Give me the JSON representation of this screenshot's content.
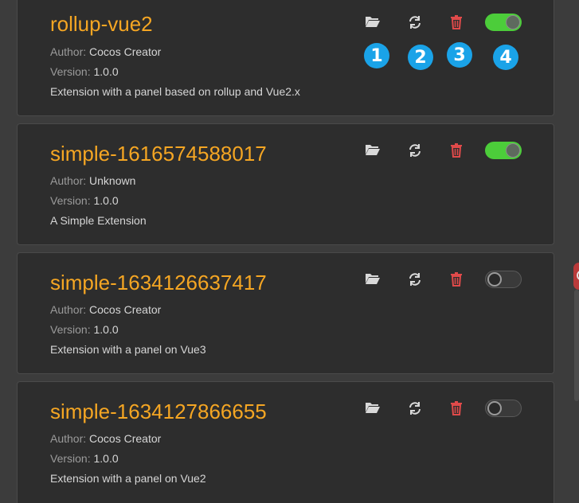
{
  "extensions": [
    {
      "name": "rollup-vue2",
      "author_label": "Author:",
      "author": "Cocos Creator",
      "version_label": "Version:",
      "version": "1.0.0",
      "description": "Extension with a panel based on rollup and Vue2.x",
      "enabled": true
    },
    {
      "name": "simple-1616574588017",
      "author_label": "Author:",
      "author": "Unknown",
      "version_label": "Version:",
      "version": "1.0.0",
      "description": "A Simple Extension",
      "enabled": true
    },
    {
      "name": "simple-1634126637417",
      "author_label": "Author:",
      "author": "Cocos Creator",
      "version_label": "Version:",
      "version": "1.0.0",
      "description": "Extension with a panel on Vue3",
      "enabled": false
    },
    {
      "name": "simple-1634127866655",
      "author_label": "Author:",
      "author": "Cocos Creator",
      "version_label": "Version:",
      "version": "1.0.0",
      "description": "Extension with a panel on Vue2",
      "enabled": false
    }
  ],
  "annotations": [
    "1",
    "2",
    "3",
    "4"
  ],
  "icons": {
    "open_folder": "folder-open-icon",
    "reload": "refresh-icon",
    "delete": "trash-icon",
    "enable": "toggle-switch"
  },
  "colors": {
    "background": "#3c3c3c",
    "card": "#2d2d2d",
    "title": "#f5a623",
    "toggle_on": "#4ccd3a",
    "delete": "#e04a4a",
    "badge": "#1aa3e8"
  }
}
